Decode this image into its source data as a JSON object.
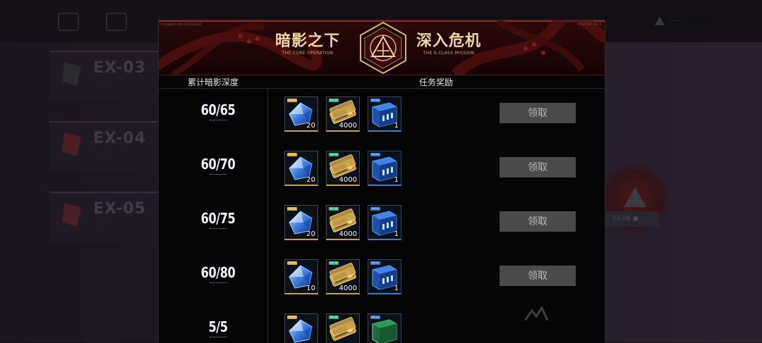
{
  "background": {
    "stages": [
      {
        "code": "EX-03",
        "sub": "······"
      },
      {
        "code": "EX-04",
        "sub": "······"
      },
      {
        "code": "EX-05",
        "sub": "······"
      }
    ],
    "emblem_tag": "EX-06 ●"
  },
  "popup": {
    "banner": {
      "tiny_left": "FOUNDATION DATABASE",
      "tiny_right": "MISSION DATA",
      "title_left_cn": "暗影之下",
      "title_left_en": "THE CORE OPERATION",
      "title_right_cn": "深入危机",
      "title_right_en": "THE S-CLASS MISSION",
      "accent_color": "#d9b56a"
    },
    "header": {
      "depth_label": "累计暗影深度",
      "rewards_label": "任务奖励"
    },
    "claim_label": "领取",
    "rows": [
      {
        "depth": "60/65",
        "rewards": [
          {
            "icon": "blue-crystal-icon",
            "tag": "PIC-1A",
            "quantity": "20"
          },
          {
            "icon": "gold-ticket-icon",
            "tag": "PIC-1B",
            "quantity": "4000"
          },
          {
            "icon": "blue-crate-icon",
            "tag": "PIC-1C",
            "quantity": "1"
          }
        ]
      },
      {
        "depth": "60/70",
        "rewards": [
          {
            "icon": "blue-crystal-icon",
            "tag": "PIC-1A",
            "quantity": "20"
          },
          {
            "icon": "gold-ticket-icon",
            "tag": "PIC-1B",
            "quantity": "4000"
          },
          {
            "icon": "blue-crate-icon",
            "tag": "PIC-1C",
            "quantity": "1"
          }
        ]
      },
      {
        "depth": "60/75",
        "rewards": [
          {
            "icon": "blue-crystal-icon",
            "tag": "PIC-1A",
            "quantity": "20"
          },
          {
            "icon": "gold-ticket-icon",
            "tag": "PIC-1B",
            "quantity": "4000"
          },
          {
            "icon": "blue-crate-icon",
            "tag": "PIC-1C",
            "quantity": "1"
          }
        ]
      },
      {
        "depth": "60/80",
        "rewards": [
          {
            "icon": "blue-crystal-icon",
            "tag": "PIC-1A",
            "quantity": "10"
          },
          {
            "icon": "gold-ticket-icon",
            "tag": "PIC-1B",
            "quantity": "4000"
          },
          {
            "icon": "blue-crate-icon",
            "tag": "PIC-1C",
            "quantity": "1"
          }
        ]
      },
      {
        "depth": "5/5",
        "rewards": [
          {
            "icon": "blue-crystal-icon",
            "tag": "PIC-1A",
            "quantity": ""
          },
          {
            "icon": "gold-ticket-icon",
            "tag": "PIC-1B",
            "quantity": ""
          },
          {
            "icon": "green-crate-icon",
            "tag": "PIC-1C",
            "quantity": ""
          }
        ]
      }
    ]
  }
}
